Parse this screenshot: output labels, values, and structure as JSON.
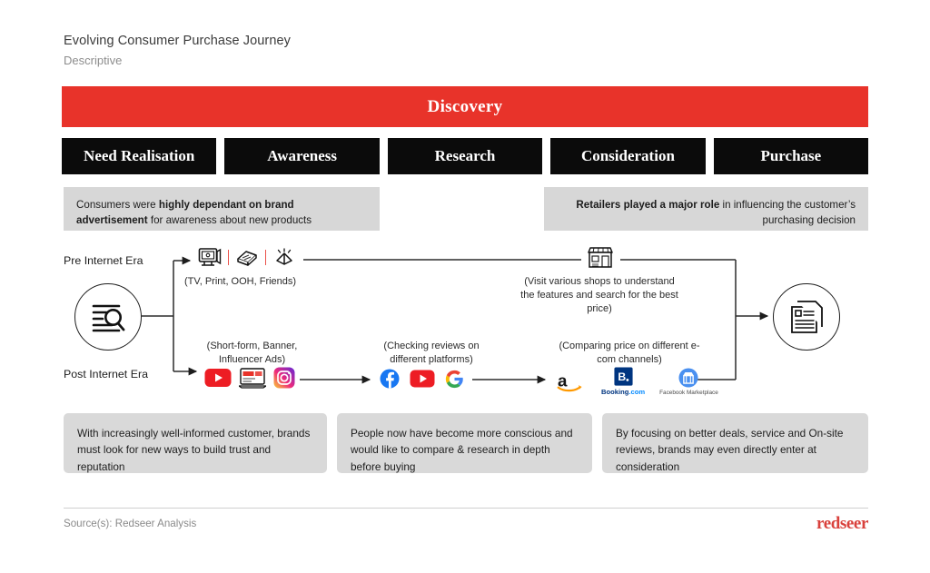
{
  "header": {
    "title": "Evolving Consumer Purchase Journey",
    "subtitle": "Descriptive"
  },
  "banner": {
    "label": "Discovery",
    "color": "#e8332a"
  },
  "stages": [
    {
      "label": "Need Realisation"
    },
    {
      "label": "Awareness"
    },
    {
      "label": "Research"
    },
    {
      "label": "Consideration"
    },
    {
      "label": "Purchase"
    }
  ],
  "callouts": {
    "left": {
      "bold": "highly dependant on brand advertisement",
      "pre": "Consumers were ",
      "post": " for awareness about new products"
    },
    "right": {
      "bold": "Retailers played a major role",
      "pre": "",
      "post": " in influencing the customer’s purchasing decision"
    }
  },
  "eras": {
    "pre": "Pre Internet Era",
    "post": "Post Internet Era"
  },
  "icons": {
    "start_circle": "search-list-icon",
    "end_circle": "documents-icon",
    "pre_internet": [
      "tv-icon",
      "newspaper-stack-icon",
      "megaphone-icon"
    ],
    "shop": "storefront-icon",
    "ads": [
      "youtube-icon",
      "banner-ad-icon",
      "instagram-icon"
    ],
    "reviews": [
      "facebook-icon",
      "youtube-icon",
      "google-icon"
    ],
    "ecom": [
      "amazon-icon",
      "booking-com-icon",
      "facebook-marketplace-icon"
    ]
  },
  "captions": {
    "pre_media": "(TV, Print, OOH, Friends)",
    "shop": "(Visit various shops to understand the features and search for the best price)",
    "ads": "(Short-form, Banner, Influencer Ads)",
    "reviews": "(Checking reviews on different platforms)",
    "ecom": "(Comparing price on different e-com channels)"
  },
  "brand_labels": {
    "booking_main": "Booking",
    "booking_dot": ".com",
    "marketplace": "Facebook Marketplace"
  },
  "bottom_boxes": [
    {
      "text": "With increasingly well-informed customer, brands must look for new ways to build trust and reputation"
    },
    {
      "text": "People now have become more conscious and would like to compare & research in depth before buying"
    },
    {
      "text": "By focusing on better deals, service and On-site reviews, brands may even directly enter at consideration"
    }
  ],
  "footer": {
    "source": "Source(s): Redseer Analysis",
    "logo": "redseer"
  }
}
